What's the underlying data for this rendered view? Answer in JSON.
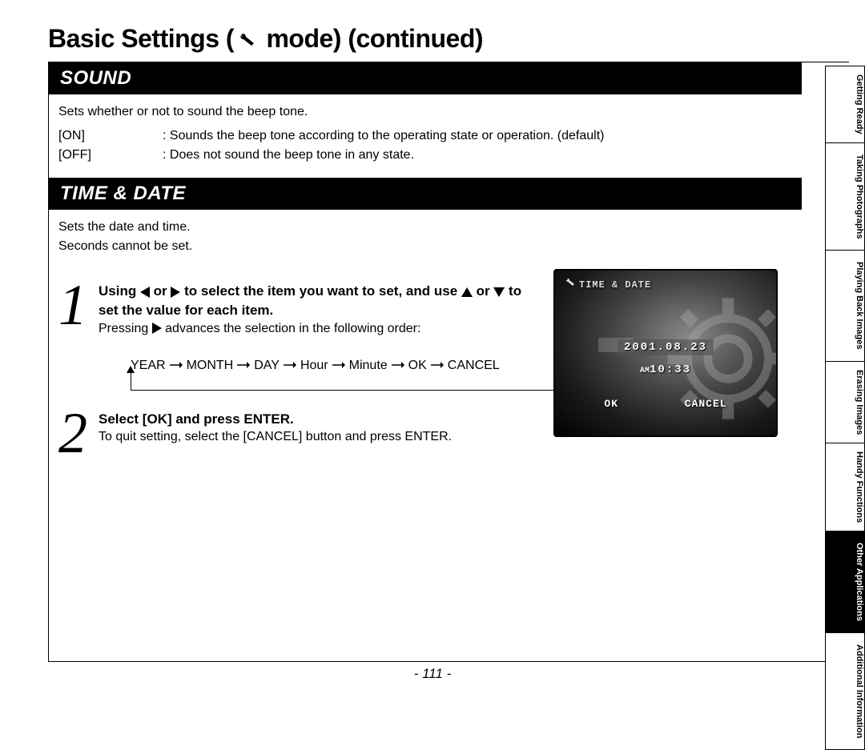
{
  "title_prefix": "Basic Settings (",
  "title_suffix": " mode) (continued)",
  "sections": {
    "sound": {
      "header": "SOUND",
      "desc": "Sets whether or not to sound the beep tone.",
      "options": [
        {
          "label": "[ON]",
          "sep": ":",
          "desc": " Sounds the beep tone according to the operating state or operation. (default)"
        },
        {
          "label": "[OFF]",
          "sep": ":",
          "desc": " Does not sound the beep tone in any state."
        }
      ]
    },
    "timedate": {
      "header": "TIME & DATE",
      "desc1": "Sets the date and time.",
      "desc2": "Seconds cannot be set.",
      "step1a": "Using ",
      "step1b": " or ",
      "step1c": " to select the item you want to set, and use ",
      "step1d": " or ",
      "step1e": " to set the value for each item.",
      "step1sub_a": "Pressing ",
      "step1sub_b": " advances the selection in the following order:",
      "flow": [
        "YEAR",
        "MONTH",
        "DAY",
        "Hour",
        "Minute",
        "OK",
        "CANCEL"
      ],
      "step2title": "Select [OK] and press ENTER.",
      "step2sub": "To quit setting, select the [CANCEL] button and press ENTER."
    }
  },
  "lcd": {
    "header": "TIME & DATE",
    "date": "2001.08.23",
    "time_ampm": "AM",
    "time": "10:33",
    "ok": "OK",
    "cancel": "CANCEL"
  },
  "tabs": [
    "Getting Ready",
    "Taking Photographs",
    "Playing Back Images",
    "Erasing Images",
    "Handy Functions",
    "Other Applications",
    "Additional Information"
  ],
  "page_number": "- 111 -"
}
